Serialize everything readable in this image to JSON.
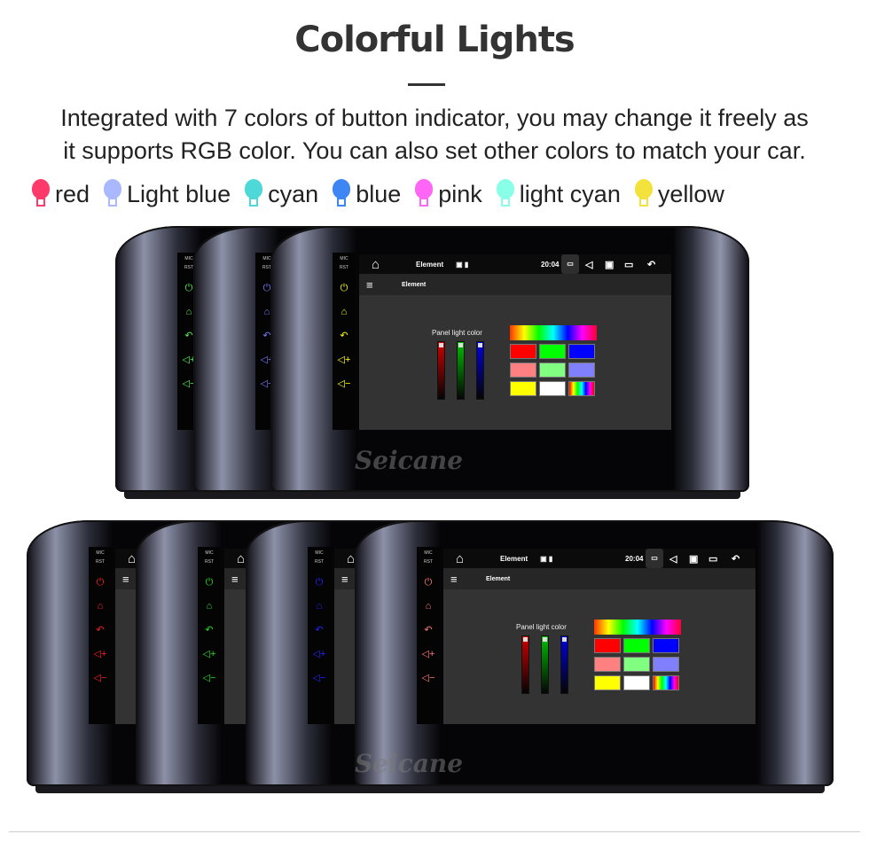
{
  "header": {
    "title": "Colorful Lights",
    "desc_line1": "Integrated with 7 colors of button indicator, you may change it freely as",
    "desc_line2": "it supports RGB color. You can also set other colors to match your car."
  },
  "legend": [
    {
      "label": "red",
      "color": "#ff3a6a"
    },
    {
      "label": "Light blue",
      "color": "#a9b8ff"
    },
    {
      "label": "cyan",
      "color": "#4fd8d8"
    },
    {
      "label": "blue",
      "color": "#3f86f5"
    },
    {
      "label": "pink",
      "color": "#ff66f5"
    },
    {
      "label": "light cyan",
      "color": "#88ffe6"
    },
    {
      "label": "yellow",
      "color": "#f4e23c"
    }
  ],
  "device": {
    "side_labels": [
      "MIC",
      "RST"
    ],
    "status_title": "Element",
    "time": "20:04",
    "app_title": "Element",
    "panel_label": "Panel light color",
    "sliders": [
      "#d00000",
      "#00c000",
      "#0000e0"
    ],
    "swatches": [
      "#ff0000",
      "#00ff00",
      "#0000ff",
      "#ff8080",
      "#80ff80",
      "#8080ff",
      "#ffff00",
      "#ffffff",
      "rainbow"
    ],
    "watermark": "Seicane"
  },
  "rows": {
    "top_button_colors": [
      "#55ee55",
      "#7a7aff",
      "#ffff00"
    ],
    "bottom_button_colors": [
      "#ff2020",
      "#22dd22",
      "#2222ff",
      "#ff7777"
    ]
  }
}
